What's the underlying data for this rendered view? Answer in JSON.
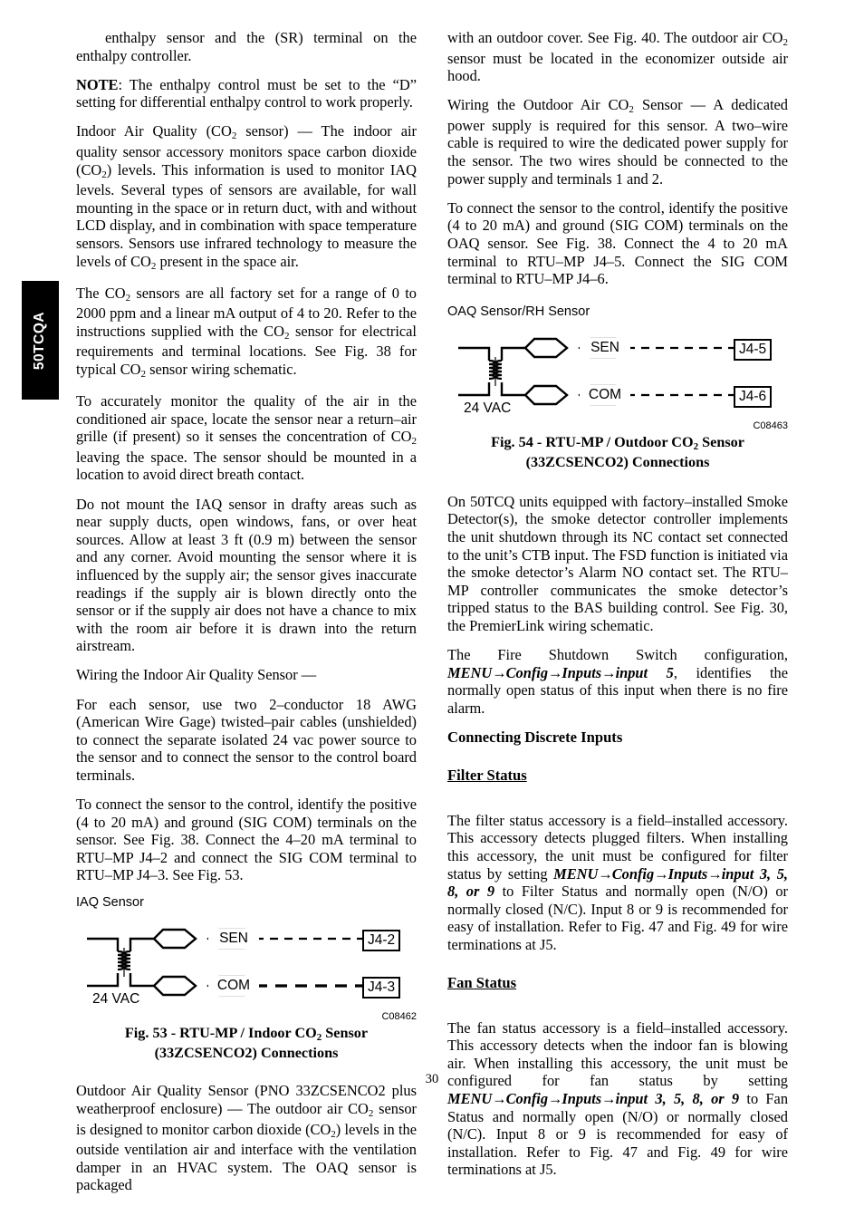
{
  "document": {
    "page_number": "30",
    "side_tab_label": "50TCQA"
  },
  "left_column": {
    "p1": "enthalpy sensor and the (SR) terminal on the enthalpy controller.",
    "note_label": "NOTE",
    "note_text": ":   The enthalpy control must be set to the “D” setting for differential enthalpy control to work properly.",
    "p2_a": "Indoor Air Quality (CO",
    "p2_b": "2",
    "p2_c": " sensor) — The indoor air quality sensor accessory monitors space carbon dioxide (CO",
    "p2_d": "2",
    "p2_e": ") levels. This information is used to monitor IAQ levels. Several types of sensors are available, for wall mounting in the space or in return duct, with and without LCD display, and in combination with space temperature sensors. Sensors use infrared technology to measure the levels of CO",
    "p2_f": "2",
    "p2_g": " present in the space air.",
    "p3_a": "The CO",
    "p3_b": "2",
    "p3_c": " sensors are all factory set for a range of 0 to 2000 ppm and a linear mA output of 4 to 20. Refer to the instructions supplied with the CO",
    "p3_d": "2",
    "p3_e": " sensor for electrical requirements and terminal locations. See Fig. 38 for typical CO",
    "p3_f": "2",
    "p3_g": " sensor wiring schematic.",
    "p4_a": "To accurately monitor the quality of the air in the conditioned air space, locate the sensor near a return–air grille (if present) so it senses the concentration of CO",
    "p4_b": "2",
    "p4_c": " leaving the space. The sensor should be mounted in a location to avoid direct breath contact.",
    "p5": "Do not mount the IAQ sensor in drafty areas such as near supply ducts, open windows, fans, or over heat sources. Allow at least 3 ft (0.9 m) between the sensor and any corner. Avoid mounting the sensor where it is influenced by the supply air; the sensor gives inaccurate readings if the supply air is blown directly onto the sensor or if the supply air does not have a chance to mix with the room air before it is drawn into the return airstream.",
    "p6": "Wiring the Indoor Air Quality Sensor —",
    "p7": "For each sensor, use two 2–conductor 18 AWG (American Wire Gage) twisted–pair cables (unshielded) to connect the separate isolated 24 vac power source to the sensor and to connect the sensor to the control board terminals.",
    "p8": "To connect the sensor to the control, identify the positive (4 to 20 mA) and ground (SIG COM) terminals on the sensor. See Fig. 38. Connect the 4–20 mA terminal to RTU–MP J4–2 and connect the SIG COM terminal to RTU–MP J4–3. See Fig. 53.",
    "p9_a": "Outdoor Air Quality Sensor (PNO 33ZCSENCO2 plus weatherproof enclosure) — The outdoor air CO",
    "p9_b": "2",
    "p9_c": " sensor is designed to monitor carbon dioxide (CO",
    "p9_d": "2",
    "p9_e": ") levels in the outside ventilation air and interface with the ventilation damper in an HVAC system. The OAQ sensor is packaged"
  },
  "figure_53": {
    "label": "IAQ Sensor",
    "power_label": "24 VAC",
    "sen_label": "SEN",
    "com_label": "COM",
    "sen_terminal": "J4-2",
    "com_terminal": "J4-3",
    "code_id": "C08462",
    "caption_line1_a": "Fig. 53 -  RTU-MP / Indoor CO",
    "caption_line1_b": "2",
    "caption_line1_c": " Sensor",
    "caption_line2": "(33ZCSENCO2) Connections"
  },
  "figure_54": {
    "label": "OAQ Sensor/RH Sensor",
    "power_label": "24 VAC",
    "sen_label": "SEN",
    "com_label": "COM",
    "sen_terminal": "J4-5",
    "com_terminal": "J4-6",
    "code_id": "C08463",
    "caption_line1_a": "Fig. 54 -  RTU-MP / Outdoor CO",
    "caption_line1_b": "2",
    "caption_line1_c": " Sensor",
    "caption_line2": "(33ZCSENCO2) Connections"
  },
  "right_column": {
    "p1_a": "with an outdoor cover. See Fig. 40. The outdoor air CO",
    "p1_b": "2",
    "p1_c": " sensor must be located in the economizer outside air hood.",
    "p2_a": "Wiring the Outdoor Air CO",
    "p2_b": "2",
    "p2_c": " Sensor — A dedicated power supply is required for this sensor. A two–wire cable is required to wire the dedicated power supply for the sensor. The two wires should be connected to the power supply and terminals 1 and 2.",
    "p3": "To connect the sensor to the control, identify the positive (4 to 20 mA) and ground (SIG COM) terminals on the OAQ sensor. See Fig. 38. Connect the 4 to 20 mA terminal to RTU–MP J4–5. Connect the SIG COM terminal to RTU–MP J4–6.",
    "p4": "On 50TCQ units equipped with factory–installed Smoke Detector(s), the smoke detector controller implements the unit shutdown through its NC contact set connected to the unit’s CTB input. The FSD function is initiated via the smoke detector’s Alarm NO contact set. The RTU–MP controller communicates the smoke detector’s tripped status to the BAS building control. See Fig. 30, the PremierLink wiring schematic.",
    "p5_pre": "The      Fire      Shutdown      Switch      configuration,",
    "p5_menu": "MENU",
    "p5_menu2": "Config",
    "p5_menu3": "Inputs",
    "p5_menu4": "input  5",
    "p5_post": ",      identifies      the normally open status of this input when there is no fire alarm.",
    "section_heading": "Connecting Discrete Inputs",
    "sub1_heading": "Filter Status",
    "sub1_p_pre": "The filter status accessory is a field–installed accessory. This accessory detects plugged filters. When installing this accessory, the unit must be configured for filter status by setting ",
    "sub1_menu": "MENU",
    "sub1_menu2": "Config",
    "sub1_menu3": "Inputs",
    "sub1_menu4": "input 3, 5, 8, or 9",
    "sub1_p_post": " to Filter Status and normally open (N/O) or normally closed (N/C). Input 8 or 9 is recommended for easy of installation. Refer to Fig. 47 and Fig. 49 for wire terminations at J5.",
    "sub2_heading": "Fan Status",
    "sub2_p_pre": "The fan status accessory is a field–installed accessory. This accessory detects when the indoor fan is blowing air. When  installing  this  accessory,  the  unit  must  be configured      for      fan      status      by      setting ",
    "sub2_menu": "MENU",
    "sub2_menu2": "Config",
    "sub2_menu3": "Inputs",
    "sub2_menu4": "input 3, 5, 8, or 9",
    "sub2_p_post": " to Fan Status and normally open (N/O) or normally closed (N/C). Input 8 or 9 is recommended for easy of installation. Refer to Fig. 47 and Fig. 49 for wire terminations at J5."
  }
}
